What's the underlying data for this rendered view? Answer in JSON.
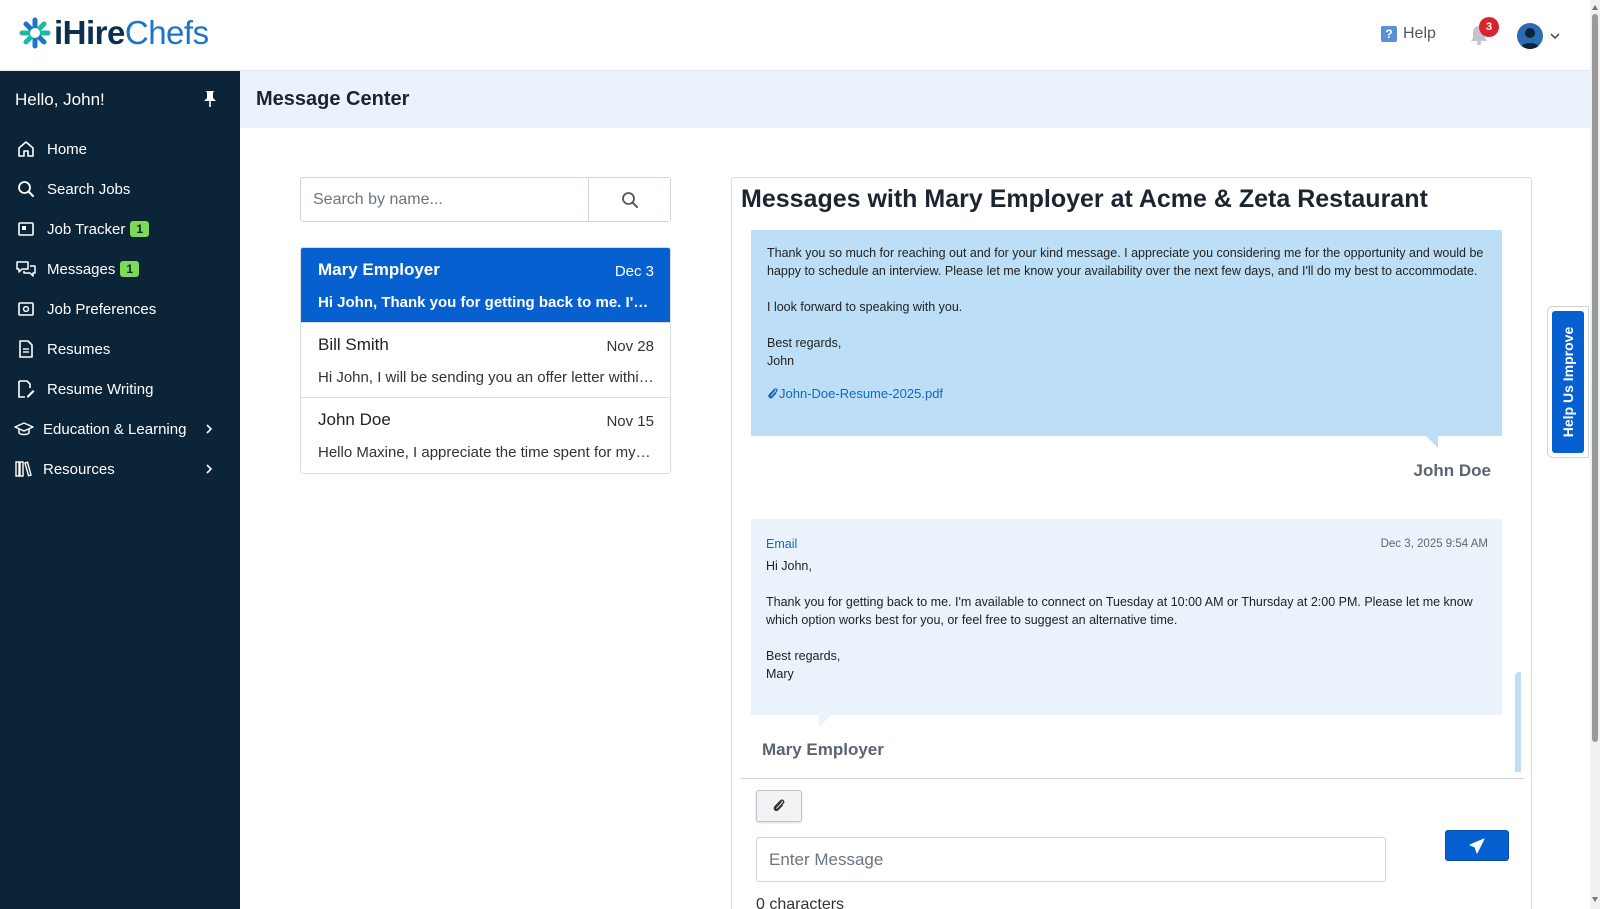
{
  "header": {
    "logo": {
      "part1": "iHire",
      "part2": "Chefs"
    },
    "help_label": "Help",
    "notification_count": "3"
  },
  "sidebar": {
    "greeting": "Hello, John!",
    "items": [
      {
        "label": "Home",
        "icon": "home-icon"
      },
      {
        "label": "Search Jobs",
        "icon": "search-icon"
      },
      {
        "label": "Job Tracker",
        "icon": "folder-icon",
        "badge": "1"
      },
      {
        "label": "Messages",
        "icon": "chat-icon",
        "badge": "1"
      },
      {
        "label": "Job Preferences",
        "icon": "preferences-icon"
      },
      {
        "label": "Resumes",
        "icon": "document-icon"
      },
      {
        "label": "Resume Writing",
        "icon": "edit-document-icon"
      },
      {
        "label": "Education & Learning",
        "icon": "graduation-cap-icon"
      },
      {
        "label": "Resources",
        "icon": "books-icon"
      }
    ]
  },
  "page": {
    "title": "Message Center"
  },
  "search": {
    "placeholder": "Search by name..."
  },
  "conversations": [
    {
      "name": "Mary Employer",
      "date": "Dec 3",
      "preview": "Hi John, Thank you for getting back to me. I'm available to connect on Tuesday",
      "active": true
    },
    {
      "name": "Bill Smith",
      "date": "Nov 28",
      "preview": "Hi John, I will be sending you an offer letter within the next few days",
      "active": false
    },
    {
      "name": "John Doe",
      "date": "Nov 15",
      "preview": "Hello Maxine, I appreciate the time spent for my interview",
      "active": false
    }
  ],
  "thread": {
    "title": "Messages with Mary Employer at Acme & Zeta Restaurant",
    "messages": [
      {
        "paragraph1": "Thank you so much for reaching out and for your kind message. I appreciate you considering me for the opportunity and would be happy to schedule an interview. Please let me know your availability over the next few days, and I'll do my best to accommodate.",
        "paragraph2": "I look forward to speaking with you.",
        "closing": "Best regards,",
        "signature": "John",
        "attachment": "John-Doe-Resume-2025.pdf",
        "sender": "John Doe"
      },
      {
        "channel": "Email",
        "timestamp": "Dec 3, 2025 9:54 AM",
        "salutation": "Hi John,",
        "paragraph1": "Thank you for getting back to me. I'm available to connect on Tuesday at 10:00 AM or Thursday at 2:00 PM. Please let me know which option works best for you, or feel free to suggest an alternative time.",
        "closing": "Best regards,",
        "signature": "Mary",
        "sender": "Mary Employer"
      }
    ]
  },
  "composer": {
    "placeholder": "Enter Message",
    "char_count": "0 characters"
  },
  "feedback_tab": {
    "label": "Help Us Improve"
  },
  "colors": {
    "sidebar_bg": "#0c2438",
    "primary": "#0660d0",
    "badge_green": "#7ed957",
    "notification_red": "#d9232e",
    "my_bubble": "#bcdff7",
    "their_bubble": "#eaf2fb"
  }
}
